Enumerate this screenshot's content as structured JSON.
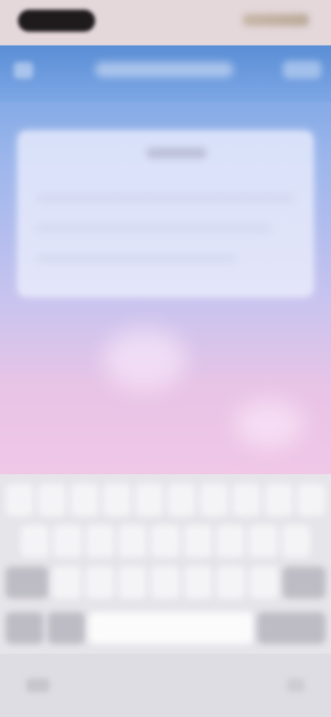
{
  "status_bar": {
    "time": "",
    "icons": [
      "signal-icon",
      "wifi-icon",
      "battery-icon"
    ]
  },
  "header": {
    "title": "",
    "back_icon": "chevron-left-icon",
    "action_label": ""
  },
  "card": {
    "title": ""
  },
  "keyboard": {
    "space_label": "",
    "globe_icon": "globe-icon",
    "mic_icon": "mic-icon"
  },
  "colors": {
    "header": "#5a8ed6",
    "gradient_bottom": "#f0c7e7",
    "keyboard": "#e6e5ea"
  }
}
